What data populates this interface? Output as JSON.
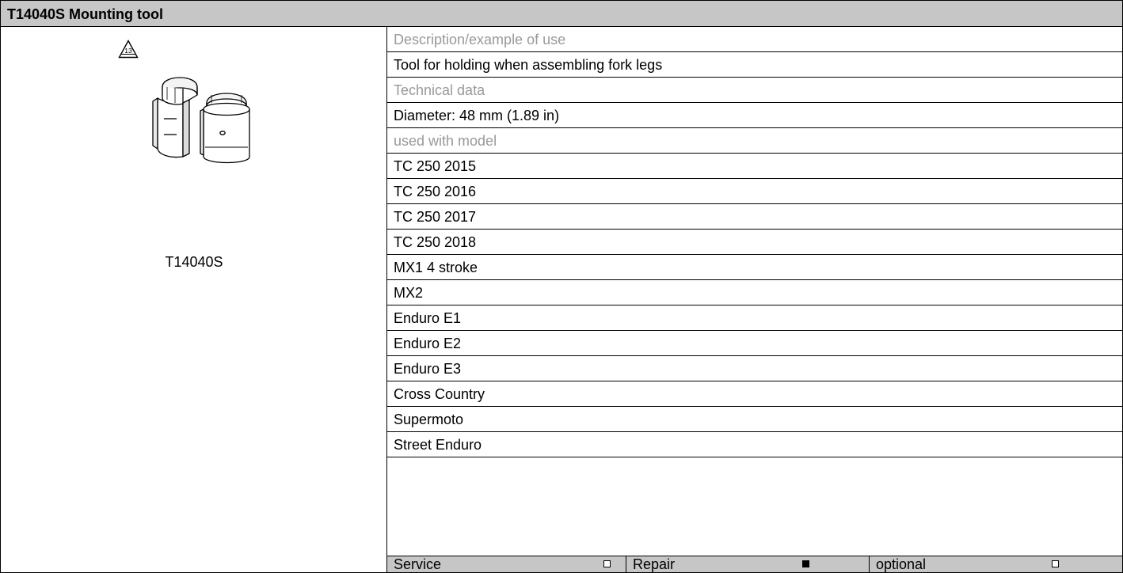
{
  "header": {
    "title": "T14040S Mounting tool"
  },
  "tool": {
    "icon": "warning-triangle-13-icon",
    "warning_number": "13",
    "caption": "T14040S"
  },
  "details": {
    "rows": [
      {
        "text": "Description/example of use",
        "style": "label"
      },
      {
        "text": "Tool for holding when assembling fork legs",
        "style": "value"
      },
      {
        "text": "Technical data",
        "style": "label"
      },
      {
        "text": "Diameter: 48 mm (1.89 in)",
        "style": "value"
      },
      {
        "text": "used with model",
        "style": "label"
      },
      {
        "text": "TC 250 2015",
        "style": "value"
      },
      {
        "text": "TC 250 2016",
        "style": "value"
      },
      {
        "text": "TC 250 2017",
        "style": "value"
      },
      {
        "text": "TC 250 2018",
        "style": "value"
      },
      {
        "text": "MX1 4 stroke",
        "style": "value"
      },
      {
        "text": "MX2",
        "style": "value"
      },
      {
        "text": "Enduro E1",
        "style": "value"
      },
      {
        "text": "Enduro E2",
        "style": "value"
      },
      {
        "text": "Enduro E3",
        "style": "value"
      },
      {
        "text": "Cross Country",
        "style": "value"
      },
      {
        "text": "Supermoto",
        "style": "value"
      },
      {
        "text": "Street Enduro",
        "style": "value"
      }
    ]
  },
  "usage": {
    "service": {
      "label": "Service",
      "checked": false
    },
    "repair": {
      "label": "Repair",
      "checked": true
    },
    "optional": {
      "label": "optional",
      "checked": false
    }
  },
  "colors": {
    "header_bg": "#c6c6c6",
    "label_text": "#999999",
    "border": "#000000"
  }
}
